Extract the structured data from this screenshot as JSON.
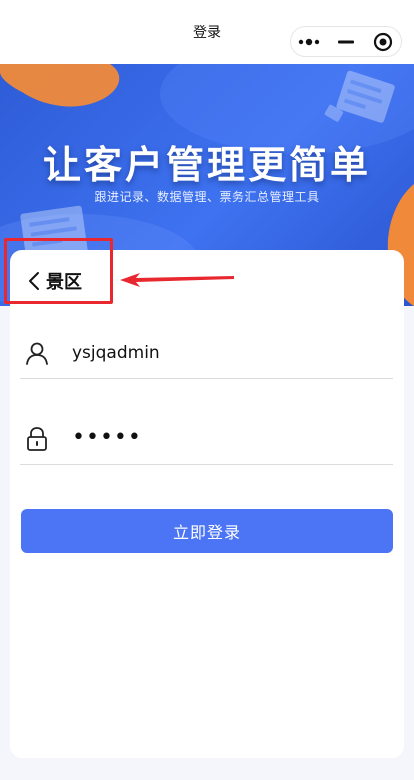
{
  "nav": {
    "title": "登录",
    "more_icon": "more-dots-icon",
    "minimize_icon": "minimize-icon",
    "close_icon": "target-close-icon"
  },
  "banner": {
    "title": "让客户管理更简单",
    "subtitle": "跟进记录、数据管理、票务汇总管理工具"
  },
  "card": {
    "back_label": "景区",
    "username_value": "ysjqadmin",
    "password_value": "•••••",
    "login_label": "立即登录"
  },
  "colors": {
    "primary": "#4b75f5",
    "banner_blue": "#3e72f0",
    "accent_orange": "#f08a3a",
    "highlight_red": "#e8272f"
  }
}
